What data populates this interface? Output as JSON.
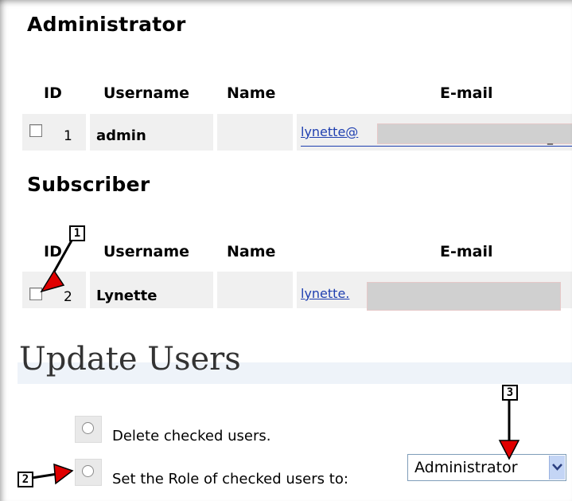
{
  "admin": {
    "heading": "Administrator",
    "columns": {
      "id": "ID",
      "username": "Username",
      "name": "Name",
      "email": "E-mail"
    },
    "rows": [
      {
        "id": "1",
        "username": "admin",
        "name": "",
        "email_visible": "lynette@",
        "email_tail": "_"
      }
    ]
  },
  "subscriber": {
    "heading": "Subscriber",
    "columns": {
      "id": "ID",
      "username": "Username",
      "name": "Name",
      "email": "E-mail"
    },
    "rows": [
      {
        "id": "2",
        "username": "Lynette",
        "name": "",
        "email_visible": "lynette."
      }
    ]
  },
  "update": {
    "title": "Update Users",
    "option_delete": "Delete checked users.",
    "option_set_role": "Set the Role of checked users to:",
    "role_select_value": "Administrator"
  },
  "callouts": {
    "one": "1",
    "two": "2",
    "three": "3"
  },
  "colors": {
    "link": "#1f3fb0",
    "row_bg": "#f0f0f0",
    "arrow_red": "#e00000",
    "bar_bg": "#eef3f9"
  }
}
